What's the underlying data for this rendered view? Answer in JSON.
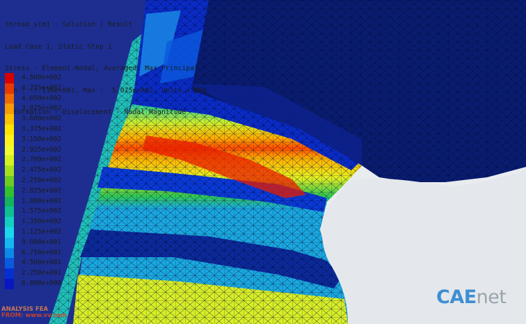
{
  "info_lines": [
    "thread_sim1 : Solution | Result",
    "Load Case 1, Static Step 1",
    "Stress - Element-Nodal, Averaged, Max Principal",
    "Min : -7.136e+001, Max :  5.075e+002, Units = MPa",
    "Deformation : Displacement - Nodal Magnitude"
  ],
  "legend": {
    "labels": [
      "4.500e+002",
      "4.275e+002",
      "4.050e+002",
      "3.825e+002",
      "3.600e+002",
      "3.375e+002",
      "3.150e+002",
      "2.925e+002",
      "2.700e+002",
      "2.475e+002",
      "2.250e+002",
      "2.025e+002",
      "1.800e+002",
      "1.575e+002",
      "1.350e+002",
      "1.125e+002",
      "9.000e+001",
      "6.750e+001",
      "4.500e+001",
      "2.250e+001",
      "0.000e+000"
    ],
    "colors": [
      "#d80000",
      "#e83a00",
      "#f06a00",
      "#f89a00",
      "#ffc200",
      "#ffe400",
      "#fff21c",
      "#f2fb2c",
      "#d6f21e",
      "#a6e01c",
      "#6ccc20",
      "#34c22c",
      "#14b45c",
      "#0ec090",
      "#14cfc0",
      "#1ad8ea",
      "#14b8ee",
      "#0a8ae8",
      "#0a5ade",
      "#0430d0",
      "#0818c0"
    ]
  },
  "watermark": {
    "line1": "ANALYSIS FEA",
    "line2": "FROM: www.vv.com"
  },
  "logo": {
    "c_part": "CAE",
    "n_part": "net"
  }
}
